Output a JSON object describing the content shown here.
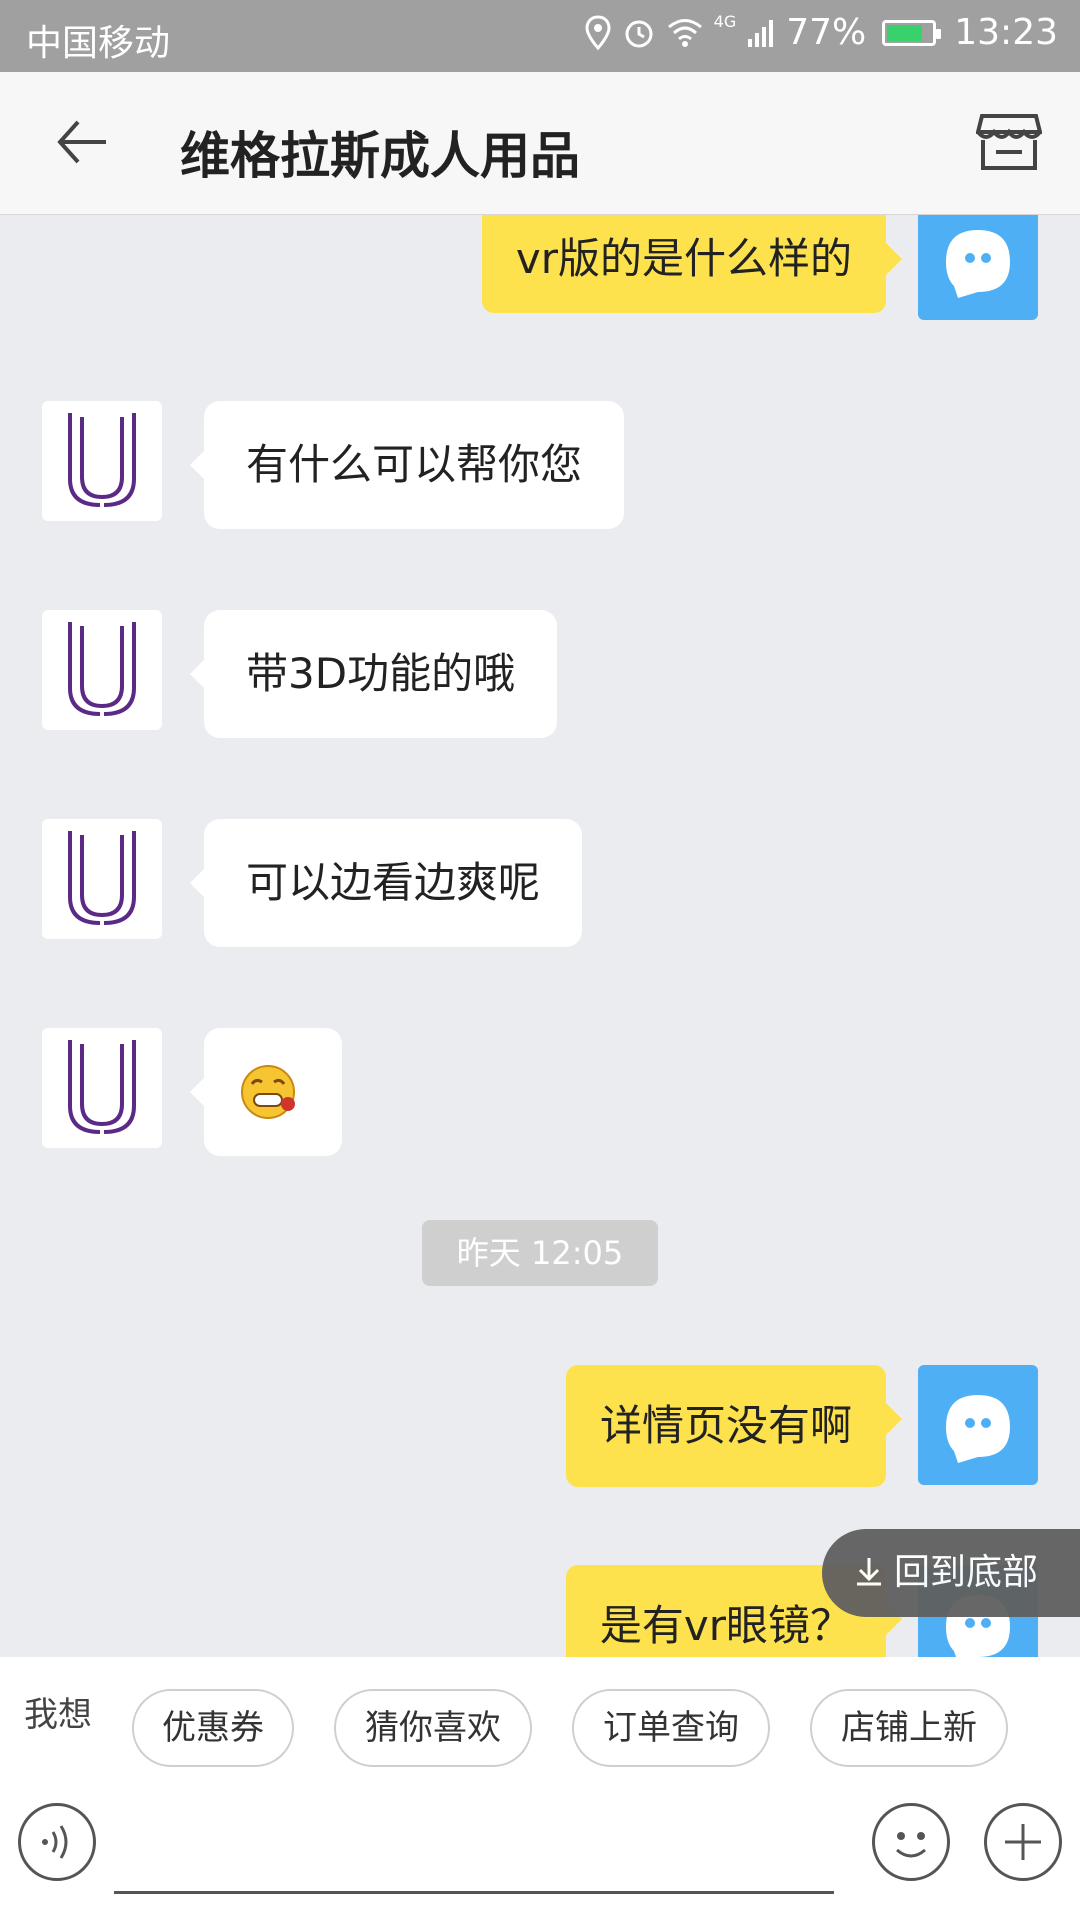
{
  "status_bar": {
    "carrier": "中国移动",
    "network": "4G",
    "battery": "77%",
    "time": "13:23"
  },
  "header": {
    "title": "维格拉斯成人用品"
  },
  "messages": [
    {
      "side": "out",
      "text": "vr版的是什么样的"
    },
    {
      "side": "in",
      "text": "有什么可以帮你您"
    },
    {
      "side": "in",
      "text": "带3D功能的哦"
    },
    {
      "side": "in",
      "text": "可以边看边爽呢"
    },
    {
      "side": "in",
      "text": "",
      "type": "emoji",
      "icon": "grin-emoji"
    },
    {
      "side": "out",
      "text": "详情页没有啊"
    },
    {
      "side": "out",
      "text": "是有vr眼镜？"
    }
  ],
  "timestamp": "昨天 12:05",
  "scroll_to_bottom": {
    "label": "回到底部"
  },
  "quick_bar": {
    "label": "我想",
    "chips": [
      "优惠券",
      "猜你喜欢",
      "订单查询",
      "店铺上新"
    ]
  },
  "input": {
    "placeholder": ""
  },
  "colors": {
    "accent_bubble": "#fde24d",
    "user_avatar": "#4eaff5",
    "brand_purple": "#5b2a86"
  }
}
